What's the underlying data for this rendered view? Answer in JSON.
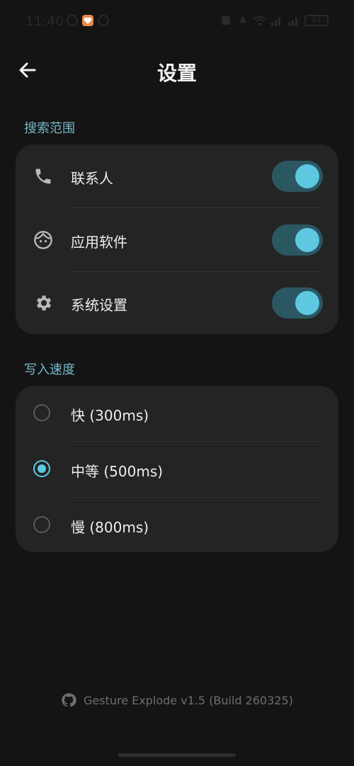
{
  "status_bar": {
    "time": "11:40",
    "battery": "81"
  },
  "header": {
    "title": "设置",
    "back_icon": "arrow-left-icon"
  },
  "search_scope": {
    "header": "搜索范围",
    "items": [
      {
        "label": "联系人",
        "icon": "phone-icon",
        "enabled": true
      },
      {
        "label": "应用软件",
        "icon": "face-icon",
        "enabled": true
      },
      {
        "label": "系统设置",
        "icon": "gear-icon",
        "enabled": true
      }
    ]
  },
  "write_speed": {
    "header": "写入速度",
    "options": [
      {
        "label": "快 (300ms)",
        "selected": false
      },
      {
        "label": "中等 (500ms)",
        "selected": true
      },
      {
        "label": "慢 (800ms)",
        "selected": false
      }
    ]
  },
  "footer": {
    "text": "Gesture Explode v1.5 (Build 260325)",
    "icon": "github-icon"
  },
  "colors": {
    "background": "#141414",
    "card": "#242424",
    "accent": "#5ec7e2",
    "toggle_track": "#2b5762",
    "section_header": "#77b8cc"
  }
}
